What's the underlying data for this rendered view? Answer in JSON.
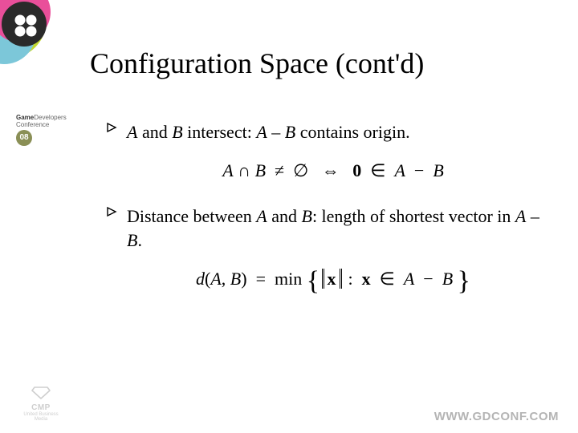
{
  "title": "Configuration Space (cont'd)",
  "bullets": [
    {
      "prefix_var1": "A",
      "mid1": " and ",
      "var2": "B",
      "mid2": " intersect: ",
      "var3": "A",
      "mid3": " – ",
      "var4": "B",
      "tail": " contains origin."
    },
    {
      "lead": "Distance between ",
      "var1": "A",
      "mid1": " and ",
      "var2": "B",
      "mid2": ": length of shortest vector in ",
      "var3": "A",
      "mid3": " – ",
      "var4": "B",
      "tail": "."
    }
  ],
  "formulas": {
    "f1": {
      "A": "A",
      "cap": "∩",
      "B": "B",
      "neq": "≠",
      "empty": "∅",
      "iff": "⇔",
      "zero": "0",
      "in": "∈",
      "minus": "−"
    },
    "f2": {
      "d": "d",
      "lp": "(",
      "A": "A",
      "comma": ",",
      "B": "B",
      "rp": ")",
      "eq": "=",
      "min": "min",
      "x": "x",
      "colon": ":",
      "in": "∈",
      "minus": "−"
    }
  },
  "footer_url": "WWW.GDCONF.COM",
  "cmp": {
    "name": "CMP",
    "sub": "United Business Media"
  },
  "conf": {
    "brand_bold": "Game",
    "brand_rest": "Developers",
    "sub": "Conference",
    "year": "08"
  }
}
